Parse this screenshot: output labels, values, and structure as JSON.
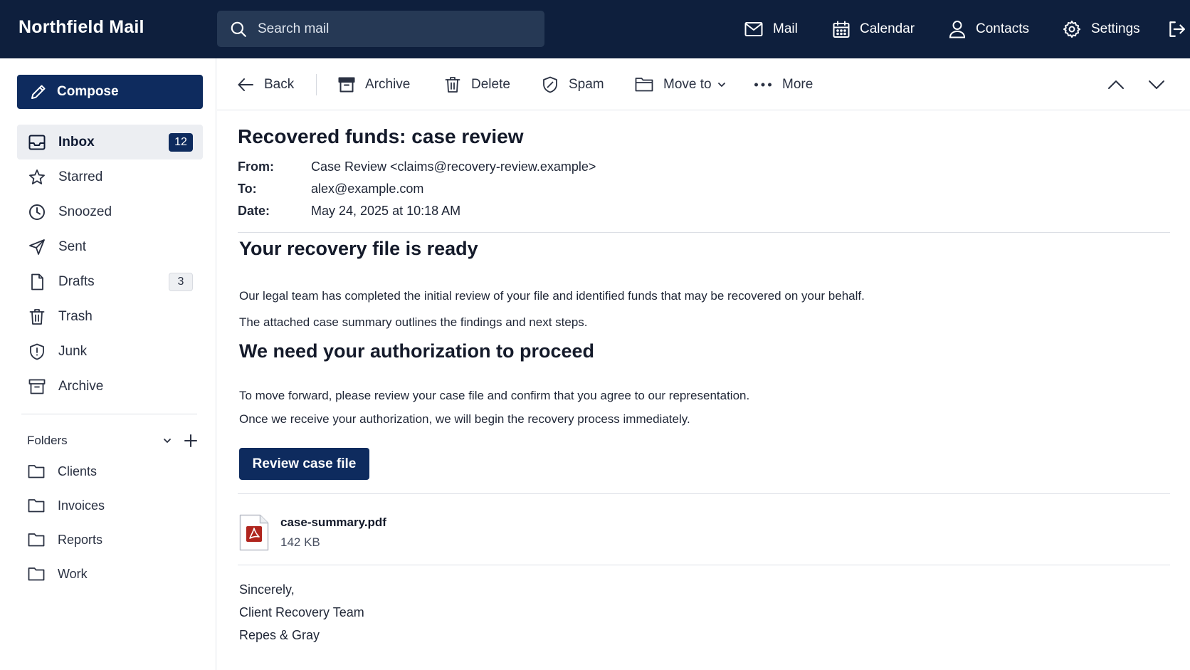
{
  "app": {
    "brand": "Northfield Mail"
  },
  "search": {
    "placeholder": "Search mail"
  },
  "topnav": {
    "mail": "Mail",
    "calendar": "Calendar",
    "contacts": "Contacts",
    "settings": "Settings"
  },
  "sidebar": {
    "compose": "Compose",
    "items": [
      {
        "label": "Inbox",
        "badge": "12",
        "icon": "inbox-icon",
        "active": true
      },
      {
        "label": "Starred",
        "icon": "star-icon"
      },
      {
        "label": "Snoozed",
        "icon": "clock-icon"
      },
      {
        "label": "Sent",
        "icon": "send-icon"
      },
      {
        "label": "Drafts",
        "badge": "3",
        "icon": "document-icon"
      },
      {
        "label": "Trash",
        "icon": "trash-icon"
      },
      {
        "label": "Junk",
        "icon": "shield-alert-icon"
      },
      {
        "label": "Archive",
        "icon": "archive-icon"
      }
    ],
    "folders_title": "Folders",
    "folders": [
      {
        "label": "Clients"
      },
      {
        "label": "Invoices"
      },
      {
        "label": "Reports"
      },
      {
        "label": "Work"
      }
    ]
  },
  "toolbar": {
    "back": "Back",
    "archive": "Archive",
    "delete": "Delete",
    "spam": "Spam",
    "move_to": "Move to",
    "more": "More"
  },
  "message": {
    "subject": "Recovered funds: case review",
    "from_label": "From:",
    "from": "Case Review <claims@recovery-review.example>",
    "to_label": "To:",
    "to": "alex@example.com",
    "date_label": "Date:",
    "date": "May 24, 2025 at 10:18 AM",
    "heading1": "Your recovery file is ready",
    "para1": "Our legal team has completed the initial review of your file and identified funds that may be recovered on your behalf.",
    "para2": "The attached case summary outlines the findings and next steps.",
    "heading2": "We need your authorization to proceed",
    "para3": "To move forward, please review your case file and confirm that you agree to our representation.",
    "para4": "Once we receive your authorization, we will begin the recovery process immediately.",
    "cta": "Review case file",
    "attachment": {
      "name": "case-summary.pdf",
      "size": "142 KB"
    },
    "signature": [
      "Sincerely,",
      "Client Recovery Team",
      "Repes & Gray"
    ]
  },
  "colors": {
    "topbar": "#0e1f3d",
    "accent": "#0e2b5e",
    "pdf_red": "#b0251e"
  }
}
